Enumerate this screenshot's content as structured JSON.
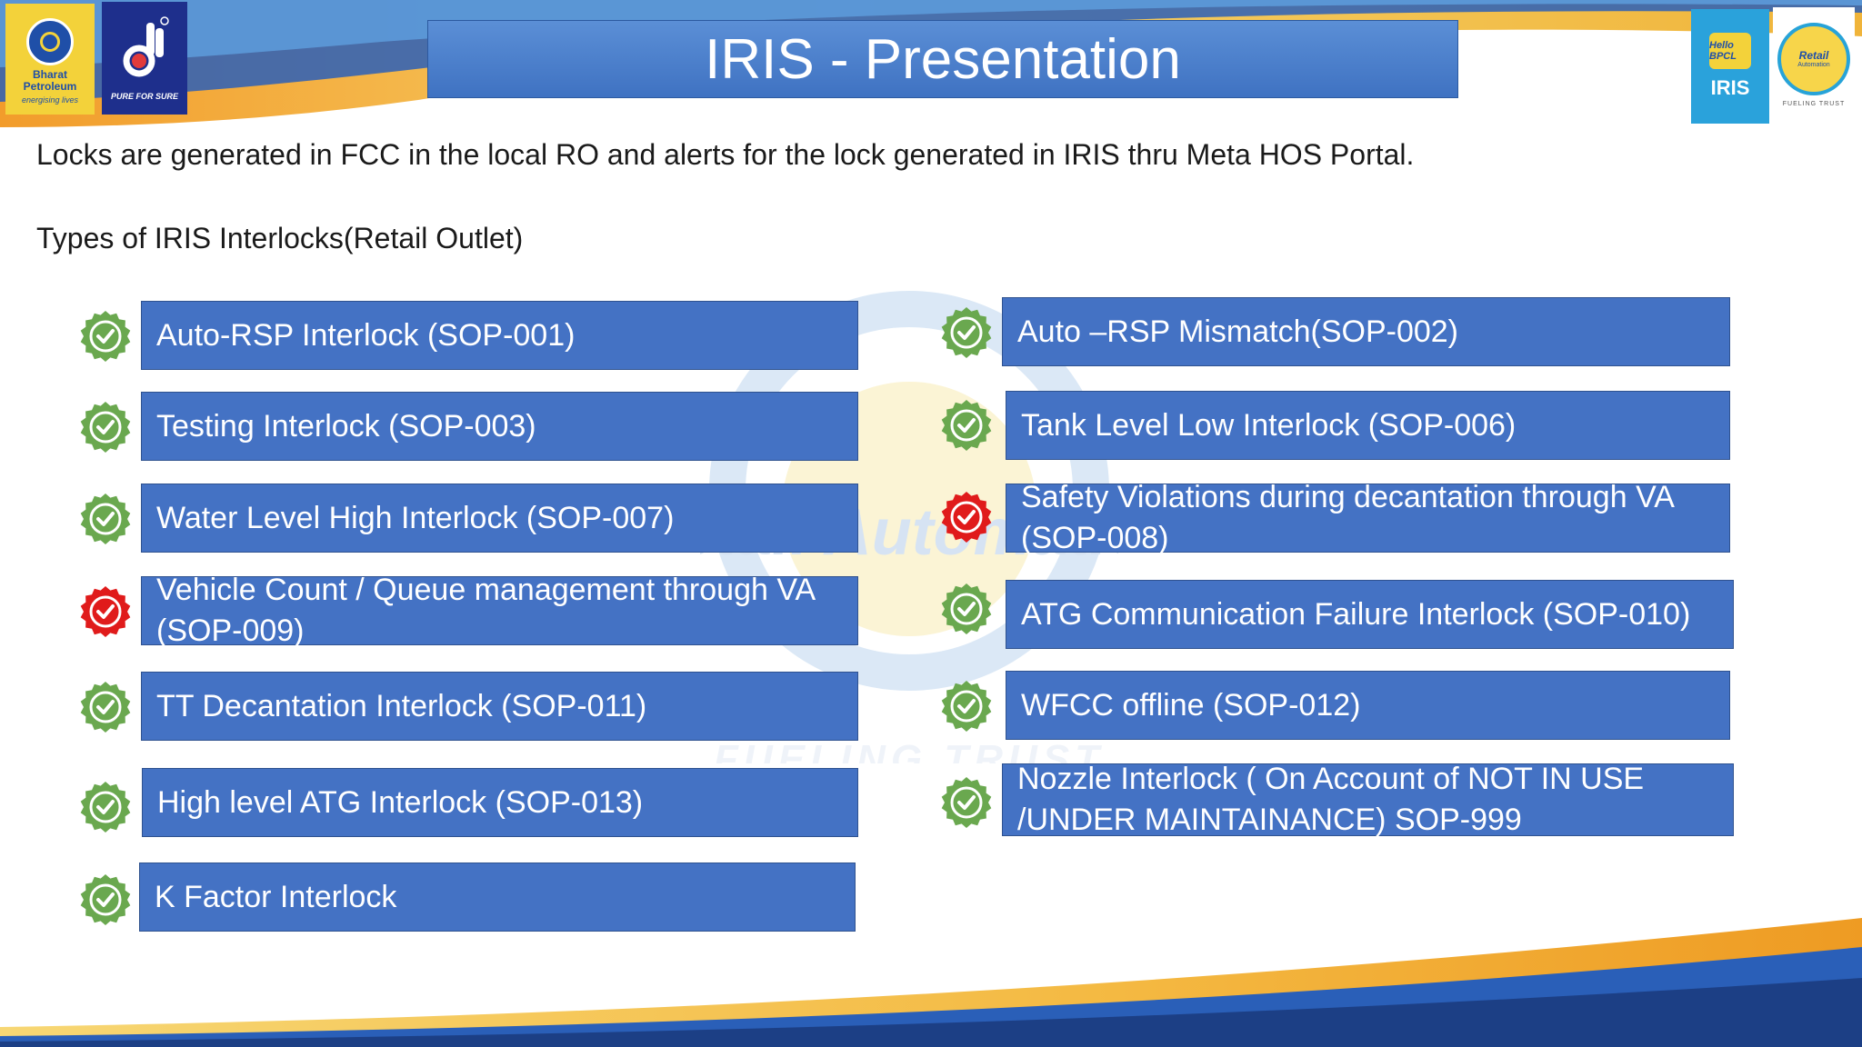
{
  "title": "IRIS - Presentation",
  "logos": {
    "bp_name": "Bharat Petroleum",
    "bp_tagline": "energising lives",
    "pfs_tagline": "PURE FOR SURE",
    "iris_hello": "Hello BPCL",
    "iris_label": "IRIS",
    "ra_label": "Retail",
    "ra_sub": "Automation",
    "ra_tagline": "FUELING TRUST"
  },
  "intro": "Locks are generated in FCC in the local RO and alerts for the lock generated in IRIS thru Meta HOS Portal.",
  "subheading": "Types of IRIS Interlocks(Retail Outlet)",
  "watermark_text": "Retail Automation",
  "watermark_tagline": "FUELING TRUST",
  "colors": {
    "box": "#4472c4",
    "ok": "#6aa84f",
    "alert": "#e01b1b",
    "title": "#4a7fcb"
  },
  "interlocks": [
    {
      "label": "Auto-RSP Interlock (SOP-001)",
      "status": "ok"
    },
    {
      "label": "Testing Interlock (SOP-003)",
      "status": "ok"
    },
    {
      "label": "Water Level High Interlock (SOP-007)",
      "status": "ok"
    },
    {
      "label": "Vehicle Count / Queue management through VA (SOP-009)",
      "status": "alert"
    },
    {
      "label": "TT Decantation Interlock (SOP-011)",
      "status": "ok"
    },
    {
      "label": "High level ATG Interlock (SOP-013)",
      "status": "ok"
    },
    {
      "label": "K Factor Interlock",
      "status": "ok"
    },
    {
      "label": "Auto –RSP Mismatch(SOP-002)",
      "status": "ok"
    },
    {
      "label": "Tank Level Low Interlock (SOP-006)",
      "status": "ok"
    },
    {
      "label": "Safety Violations during decantation through VA (SOP-008)",
      "status": "alert"
    },
    {
      "label": "ATG Communication Failure Interlock (SOP-010)",
      "status": "ok"
    },
    {
      "label": "WFCC offline (SOP-012)",
      "status": "ok"
    },
    {
      "label": "Nozzle Interlock ( On Account of NOT IN USE /UNDER MAINTAINANCE) SOP-999",
      "status": "ok"
    }
  ]
}
